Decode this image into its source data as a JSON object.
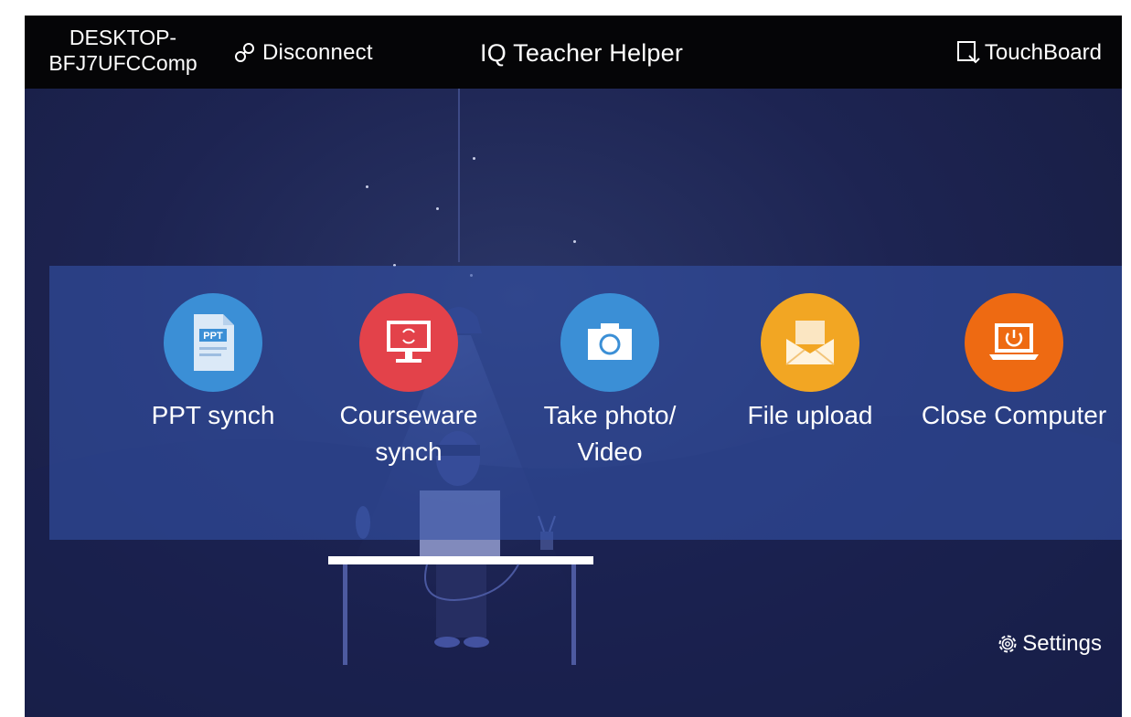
{
  "topbar": {
    "device_name": "DESKTOP-\nBFJ7UFCComp",
    "disconnect_label": "Disconnect",
    "app_title": "IQ Teacher Helper",
    "touchboard_label": "TouchBoard",
    "icons": {
      "disconnect": "link-icon",
      "touchboard": "touchboard-icon"
    }
  },
  "functions": [
    {
      "label": "PPT synch",
      "icon": "ppt-file-icon",
      "badge_text": "PPT",
      "color": "#3b8fd6"
    },
    {
      "label": "Courseware\nsynch",
      "icon": "monitor-sync-icon",
      "color": "#e3424a"
    },
    {
      "label": "Take photo/\nVideo",
      "icon": "camera-icon",
      "color": "#3b8fd6"
    },
    {
      "label": "File upload",
      "icon": "envelope-upload-icon",
      "color": "#f2a623"
    },
    {
      "label": "Close Computer",
      "icon": "power-laptop-icon",
      "color": "#ee6a12"
    }
  ],
  "settings": {
    "label": "Settings",
    "icon": "gear-icon"
  },
  "colors": {
    "topbar_bg": "#050507",
    "background": "#1d2452",
    "panel": "#3450a5"
  }
}
